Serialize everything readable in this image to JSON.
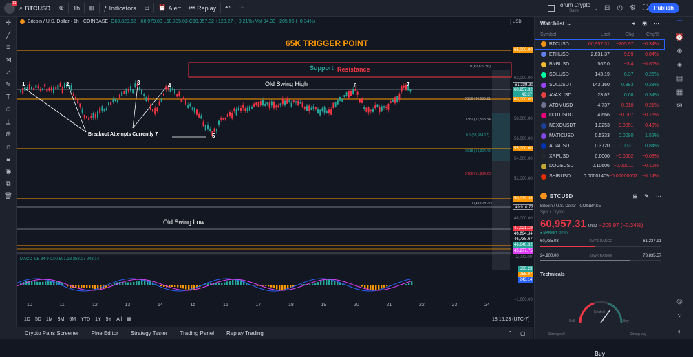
{
  "toolbar": {
    "badge": "11",
    "symbol": "BTCUSD",
    "interval": "1h",
    "indicators": "Indicators",
    "alert": "Alert",
    "replay": "Replay",
    "layout_name": "Torum Crypto",
    "layout_sub": "Save",
    "publish": "Publish"
  },
  "chart": {
    "legend_title": "Bitcoin / U.S. Dollar · 1h · COINBASE",
    "legend_ohlc": "O60,829.62 H60,970.00 L60,735.03 C60,957.32 +128.27 (+0.21%) Vol 94.33 −205.96 (−0.34%)",
    "currency": "USD",
    "trigger_title": "65K TRIGGER POINT",
    "support_text": "Support",
    "resistance_text": "Resistance",
    "old_swing_high": "Old Swing High",
    "old_swing_low": "Old Swing Low",
    "breakout_text": "Breakout Attempts Currently 7",
    "points": [
      "1",
      "2",
      "3",
      "4",
      "5",
      "6",
      "7"
    ],
    "fib_labels": [
      "0 (62,839.56)",
      "0.236 (60,580.21)",
      "0.382 (57,563.84)",
      "0.5 (55,934.17)",
      "0.618 (54,304.49)",
      "0.786 (51,984.28)",
      "1 (49,028.77)"
    ],
    "price_axis": [
      "65,000.00",
      "62,000.00",
      "61,239.30",
      "60,957.32",
      "46:37",
      "60,000.00",
      "58,000.00",
      "56,000.00",
      "55,000.00",
      "54,000.00",
      "52,000.00",
      "50,039.38",
      "49,910.77",
      "48,000.00",
      "47,021.19",
      "46,894.34",
      "46,735.67",
      "46,648.32",
      "45,277.75",
      "2,000.00",
      "500.23",
      "258.07",
      "243.14",
      "−1,000.00"
    ],
    "indicator_legend": "MACD_LB 34 9 0.00 501.23 258.07 243.14",
    "time_labels": [
      "10",
      "11",
      "12",
      "13",
      "14",
      "15",
      "16",
      "17",
      "18",
      "19",
      "20",
      "21",
      "22",
      "23",
      "24"
    ],
    "timeframes": [
      "1D",
      "5D",
      "1M",
      "3M",
      "6M",
      "YTD",
      "1Y",
      "5Y",
      "All"
    ],
    "clock": "18:15:23 (UTC-7)"
  },
  "bottom_tabs": [
    "Crypto Pairs Screener",
    "Pine Editor",
    "Strategy Tester",
    "Trading Panel",
    "Replay Trading"
  ],
  "watchlist": {
    "title": "Watchlist",
    "cols": [
      "Symbol",
      "Last",
      "Chg",
      "Chg%"
    ],
    "rows": [
      {
        "sym": "BTCUSD",
        "last": "60,957.31",
        "chg": "−205.97",
        "pct": "−0.34%",
        "color": "#f7931a",
        "neg": true
      },
      {
        "sym": "ETHUSD",
        "last": "2,631.37",
        "chg": "−9.99",
        "pct": "−0.04%",
        "color": "#627eea",
        "neg": true
      },
      {
        "sym": "BNBUSD",
        "last": "567.0",
        "chg": "−3.4",
        "pct": "−0.60%",
        "color": "#f3ba2f",
        "neg": true
      },
      {
        "sym": "SOLUSD",
        "last": "143.19",
        "chg": "0.37",
        "pct": "0.26%",
        "color": "#00ffa3",
        "neg": false
      },
      {
        "sym": "SOLUSDT",
        "last": "143.160",
        "chg": "0.393",
        "pct": "0.28%",
        "color": "#9945ff",
        "neg": false
      },
      {
        "sym": "AVAXUSD",
        "last": "23.62",
        "chg": "0.08",
        "pct": "0.34%",
        "color": "#e84142",
        "neg": false
      },
      {
        "sym": "ATOMUSD",
        "last": "4.737",
        "chg": "−0.010",
        "pct": "−0.21%",
        "color": "#6f7390",
        "neg": true
      },
      {
        "sym": "DOTUSDC",
        "last": "4.666",
        "chg": "−0.007",
        "pct": "−0.15%",
        "color": "#e6007a",
        "neg": true
      },
      {
        "sym": "NEXOUSDT",
        "last": "1.0253",
        "chg": "−0.0051",
        "pct": "−0.49%",
        "color": "#1a4199",
        "neg": true
      },
      {
        "sym": "MATICUSD",
        "last": "0.5333",
        "chg": "0.0080",
        "pct": "1.52%",
        "color": "#8247e5",
        "neg": false
      },
      {
        "sym": "ADAUSD",
        "last": "0.3720",
        "chg": "0.0031",
        "pct": "0.84%",
        "color": "#0033ad",
        "neg": false
      },
      {
        "sym": "XRPUSD",
        "last": "0.6000",
        "chg": "−0.0002",
        "pct": "−0.03%",
        "color": "#23292f",
        "neg": true
      },
      {
        "sym": "DOGEUSD",
        "last": "0.10606",
        "chg": "−0.00011",
        "pct": "−0.10%",
        "color": "#c2a633",
        "neg": true
      },
      {
        "sym": "SHIBUSD",
        "last": "0.00001409",
        "chg": "−0.00000002",
        "pct": "−0.14%",
        "color": "#e42d04",
        "neg": true
      }
    ]
  },
  "detail": {
    "symbol": "BTCUSD",
    "desc": "Bitcoin / U.S. Dollar · COINBASE",
    "type": "Spot • Crypto",
    "price": "60,957.31",
    "currency": "USD",
    "change": "−205.97 (−0.34%)",
    "status": "● MARKET OPEN",
    "day_low": "60,735.03",
    "day_label": "DAY'S RANGE",
    "day_high": "61,237.91",
    "wk_low": "24,900.00",
    "wk_label": "52WK RANGE",
    "wk_high": "73,835.57",
    "technicals": "Technicals",
    "gauge_labels": [
      "Neutral",
      "Sell",
      "Buy",
      "Strong sell",
      "Strong buy"
    ],
    "gauge_value": "Buy"
  }
}
